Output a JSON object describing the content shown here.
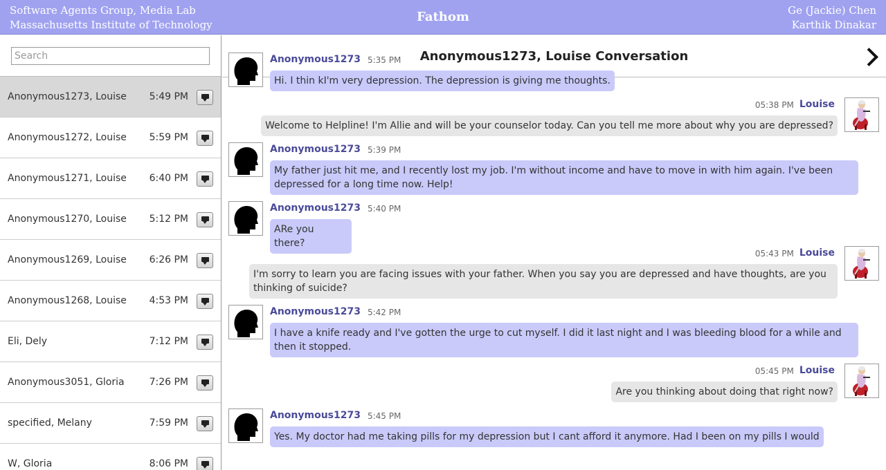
{
  "header": {
    "org_line1": "Software Agents Group, Media Lab",
    "org_line2": "Massachusetts Institute of Technology",
    "app_title": "Fathom",
    "author_line1": "Ge (Jackie) Chen",
    "author_line2": "Karthik Dinakar"
  },
  "search": {
    "placeholder": "Search",
    "value": ""
  },
  "conversations": [
    {
      "name": "Anonymous1273, Louise",
      "time": "5:49 PM",
      "active": true
    },
    {
      "name": "Anonymous1272, Louise",
      "time": "5:59 PM"
    },
    {
      "name": "Anonymous1271, Louise",
      "time": "6:40 PM"
    },
    {
      "name": "Anonymous1270, Louise",
      "time": "5:12 PM"
    },
    {
      "name": "Anonymous1269, Louise",
      "time": "6:26 PM"
    },
    {
      "name": "Anonymous1268, Louise",
      "time": "4:53 PM"
    },
    {
      "name": "Eli, Dely",
      "time": "7:12 PM"
    },
    {
      "name": "Anonymous3051, Gloria",
      "time": "7:26 PM"
    },
    {
      "name": "specified, Melany",
      "time": "7:59 PM"
    },
    {
      "name": "W, Gloria",
      "time": "8:06 PM"
    }
  ],
  "conversation": {
    "title": "Anonymous1273, Louise Conversation",
    "next_icon": "chevron-right-icon",
    "messages": [
      {
        "sender": "Anonymous1273",
        "time": "5:35 PM",
        "role": "user",
        "text": "Hi. I thin kI'm very depression. The depression is giving me thoughts."
      },
      {
        "sender": "Louise",
        "time": "05:38 PM",
        "role": "counselor",
        "text": "Welcome to Helpline! I'm Allie and will be your counselor today. Can you tell me more about why you are depressed?"
      },
      {
        "sender": "Anonymous1273",
        "time": "5:39 PM",
        "role": "user",
        "text": "My father just hit me, and I recently lost my job. I'm without income and have to move in with him again. I've been depressed for a long time now. Help!"
      },
      {
        "sender": "Anonymous1273",
        "time": "5:40 PM",
        "role": "user",
        "text": "ARe you there?"
      },
      {
        "sender": "Louise",
        "time": "05:43 PM",
        "role": "counselor",
        "text": "I'm sorry to learn you are facing issues with your father. When you say you are depressed and have thoughts, are you thinking of suicide?"
      },
      {
        "sender": "Anonymous1273",
        "time": "5:42 PM",
        "role": "user",
        "text": "I have a knife ready and I've gotten the urge to cut myself. I did it last night and I was bleeding blood for a while and then it stopped."
      },
      {
        "sender": "Louise",
        "time": "05:45 PM",
        "role": "counselor",
        "text": "Are you thinking about doing that right now?"
      },
      {
        "sender": "Anonymous1273",
        "time": "5:45 PM",
        "role": "user",
        "text": "Yes. My doctor had me taking pills for my depression but I cant afford it anymore. Had I been on my pills I would"
      }
    ]
  },
  "colors": {
    "header_bg": "#a0a2f0",
    "user_bubble": "#c9cafa",
    "counselor_bubble": "#e6e6e6",
    "sender_name": "#4a4a9a"
  }
}
